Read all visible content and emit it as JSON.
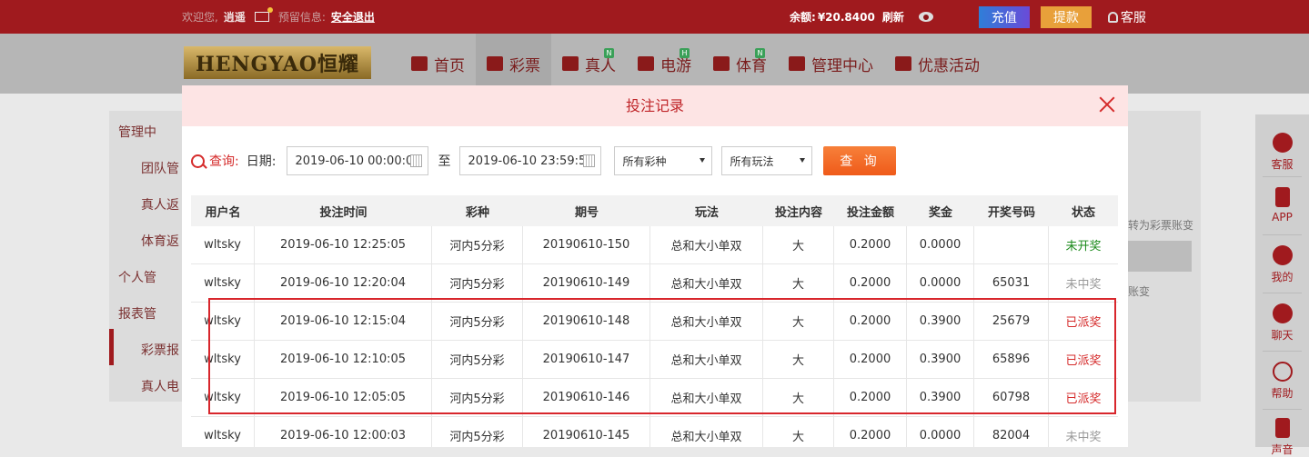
{
  "topbar": {
    "welcome": "欢迎您,",
    "username": "逍遥",
    "notice_label": "预留信息:",
    "logout": "安全退出",
    "balance_label": "余额:",
    "balance": "¥20.8400",
    "refresh": "刷新",
    "recharge": "充值",
    "withdraw": "提款",
    "service": "客服"
  },
  "brand": {
    "logo_text": "HENGYAO恒耀"
  },
  "nav": [
    {
      "label": "首页",
      "icon": "home-icon"
    },
    {
      "label": "彩票",
      "icon": "ticket-icon"
    },
    {
      "label": "真人",
      "icon": "dealer-icon",
      "badge": "N"
    },
    {
      "label": "电游",
      "icon": "slot-icon",
      "badge": "H"
    },
    {
      "label": "体育",
      "icon": "trophy-icon",
      "badge": "N"
    },
    {
      "label": "管理中心",
      "icon": "users-icon"
    },
    {
      "label": "优惠活动",
      "icon": "gift-icon"
    }
  ],
  "sidebar": {
    "head1": "管理中",
    "item1": "团队管",
    "item2": "真人返",
    "item3": "体育返",
    "head2": "个人管",
    "head3": "报表管",
    "item4": "彩票报",
    "item5": "真人电"
  },
  "bg_right": {
    "text1": "转为彩票账变",
    "text2": "账变"
  },
  "floatbar": [
    {
      "label": "客服",
      "icon": "headset-icon"
    },
    {
      "label": "APP",
      "icon": "phone-icon"
    },
    {
      "label": "我的",
      "icon": "user-icon"
    },
    {
      "label": "聊天",
      "icon": "chat-icon"
    },
    {
      "label": "帮助",
      "icon": "help-icon"
    },
    {
      "label": "声音",
      "icon": "speaker-icon"
    }
  ],
  "modal": {
    "title": "投注记录",
    "query_label": "查询:",
    "date_label": "日期:",
    "start_date": "2019-06-10 00:00:00",
    "to": "至",
    "end_date": "2019-06-10 23:59:59",
    "lottery_select": "所有彩种",
    "play_select": "所有玩法",
    "query_button": "查 询"
  },
  "table": {
    "columns": [
      "用户名",
      "投注时间",
      "彩种",
      "期号",
      "玩法",
      "投注内容",
      "投注金额",
      "奖金",
      "开奖号码",
      "状态"
    ],
    "rows": [
      [
        "wltsky",
        "2019-06-10 12:25:05",
        "河内5分彩",
        "20190610-150",
        "总和大小单双",
        "大",
        "0.2000",
        "0.0000",
        "",
        "未开奖"
      ],
      [
        "wltsky",
        "2019-06-10 12:20:04",
        "河内5分彩",
        "20190610-149",
        "总和大小单双",
        "大",
        "0.2000",
        "0.0000",
        "65031",
        "未中奖"
      ],
      [
        "wltsky",
        "2019-06-10 12:15:04",
        "河内5分彩",
        "20190610-148",
        "总和大小单双",
        "大",
        "0.2000",
        "0.3900",
        "25679",
        "已派奖"
      ],
      [
        "wltsky",
        "2019-06-10 12:10:05",
        "河内5分彩",
        "20190610-147",
        "总和大小单双",
        "大",
        "0.2000",
        "0.3900",
        "65896",
        "已派奖"
      ],
      [
        "wltsky",
        "2019-06-10 12:05:05",
        "河内5分彩",
        "20190610-146",
        "总和大小单双",
        "大",
        "0.2000",
        "0.3900",
        "60798",
        "已派奖"
      ],
      [
        "wltsky",
        "2019-06-10 12:00:03",
        "河内5分彩",
        "20190610-145",
        "总和大小单双",
        "大",
        "0.2000",
        "0.0000",
        "82004",
        "未中奖"
      ]
    ]
  },
  "colors": {
    "brand_red": "#a01a1e",
    "won": "#d52b2b",
    "pending": "#1a8a1a",
    "lost": "#999999",
    "highlight": "#d8262c"
  }
}
